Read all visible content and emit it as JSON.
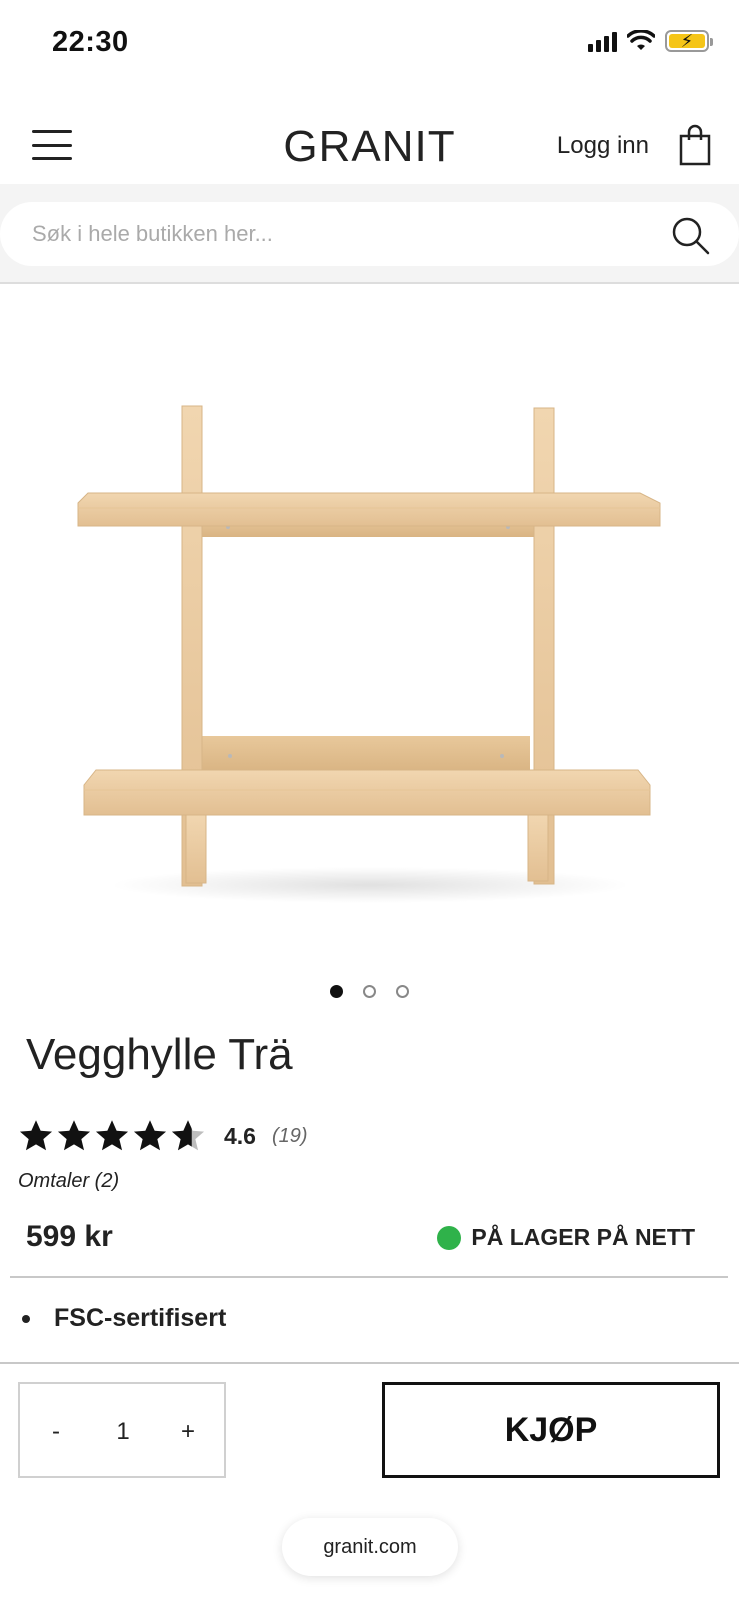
{
  "status_bar": {
    "time": "22:30",
    "icons": [
      "signal-icon",
      "wifi-icon",
      "battery-charging-icon"
    ]
  },
  "header": {
    "logo": "GRANIT",
    "login_label": "Logg inn",
    "menu_icon": "hamburger-menu-icon",
    "cart_icon": "shopping-bag-icon"
  },
  "search": {
    "placeholder": "Søk i hele butikken her...",
    "icon": "search-icon"
  },
  "product": {
    "image": "wooden-wall-shelf-photo",
    "carousel": {
      "count": 3,
      "active_index": 0
    },
    "title": "Vegghylle Trä",
    "rating": {
      "value": "4.6",
      "count": "(19)",
      "stars": 4.6,
      "max": 5
    },
    "reviews_label": "Omtaler (2)",
    "price": "599 kr",
    "stock": {
      "label": "PÅ LAGER PÅ NETT",
      "color": "#2fb24a"
    },
    "features": [
      "FSC-sertifisert"
    ]
  },
  "purchase": {
    "minus_label": "-",
    "quantity": "1",
    "plus_label": "+",
    "buy_label": "KJØP"
  },
  "browser": {
    "domain": "granit.com"
  }
}
